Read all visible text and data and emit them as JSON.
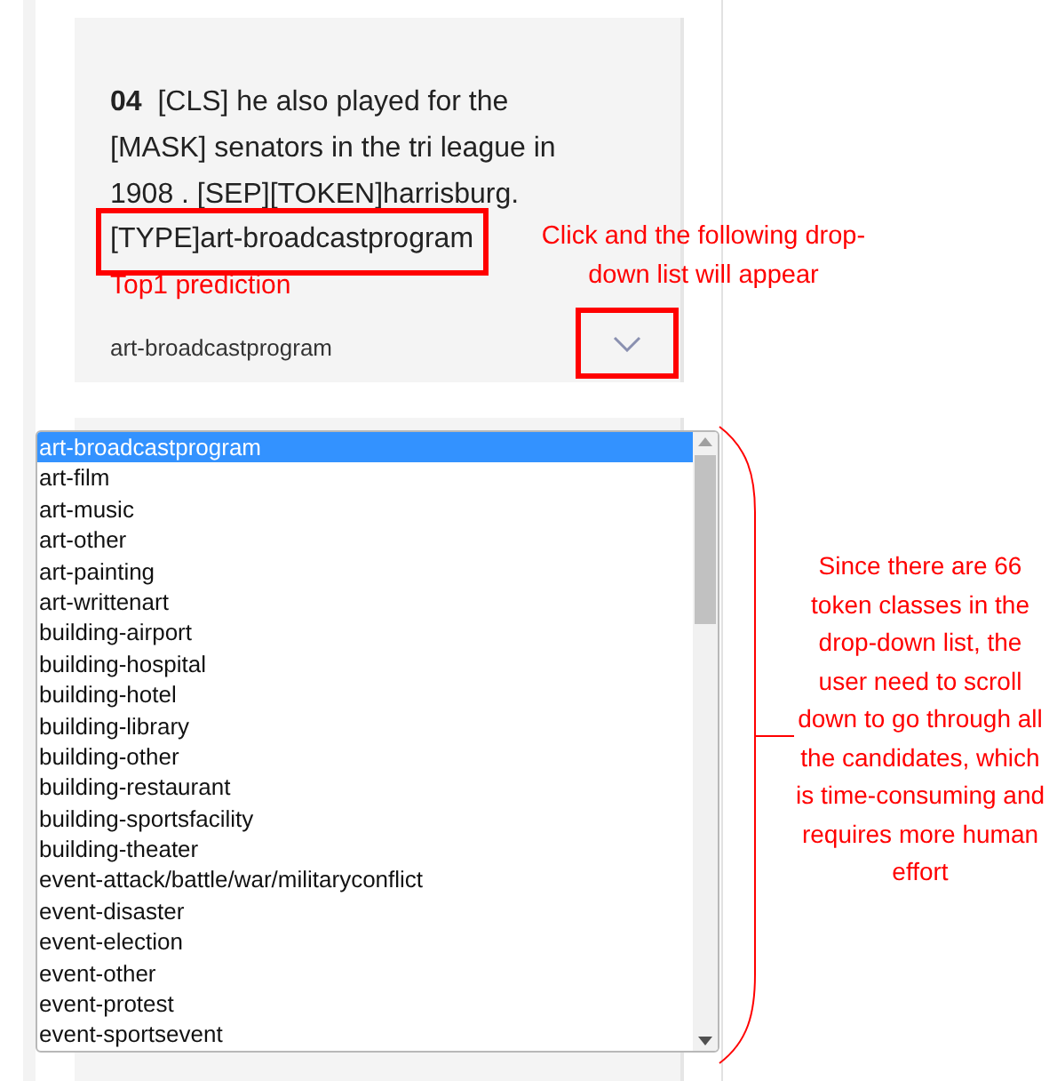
{
  "card": {
    "number": "04",
    "sentence": "[CLS] he also played for the [MASK] senators in the tri league in 1908 . [SEP][TOKEN]harrisburg.",
    "type_text": "[TYPE]art-broadcastprogram",
    "prediction": "art-broadcastprogram",
    "dropdown_expanded": false
  },
  "dropdown": {
    "options": [
      {
        "label": "art-broadcastprogram",
        "selected": true
      },
      {
        "label": "art-film",
        "selected": false
      },
      {
        "label": "art-music",
        "selected": false
      },
      {
        "label": "art-other",
        "selected": false
      },
      {
        "label": "art-painting",
        "selected": false
      },
      {
        "label": "art-writtenart",
        "selected": false
      },
      {
        "label": "building-airport",
        "selected": false
      },
      {
        "label": "building-hospital",
        "selected": false
      },
      {
        "label": "building-hotel",
        "selected": false
      },
      {
        "label": "building-library",
        "selected": false
      },
      {
        "label": "building-other",
        "selected": false
      },
      {
        "label": "building-restaurant",
        "selected": false
      },
      {
        "label": "building-sportsfacility",
        "selected": false
      },
      {
        "label": "building-theater",
        "selected": false
      },
      {
        "label": "event-attack/battle/war/militaryconflict",
        "selected": false
      },
      {
        "label": "event-disaster",
        "selected": false
      },
      {
        "label": "event-election",
        "selected": false
      },
      {
        "label": "event-other",
        "selected": false
      },
      {
        "label": "event-protest",
        "selected": false
      },
      {
        "label": "event-sportsevent",
        "selected": false
      }
    ]
  },
  "annotations": {
    "prediction_label": "Top1 prediction",
    "dropdown_hint": "Click and the following drop-down list will appear",
    "scroll_note": "Since there are 66 token classes in the drop-down list, the user need to scroll down to go through all the candidates, which is time-consuming and requires more human effort"
  }
}
